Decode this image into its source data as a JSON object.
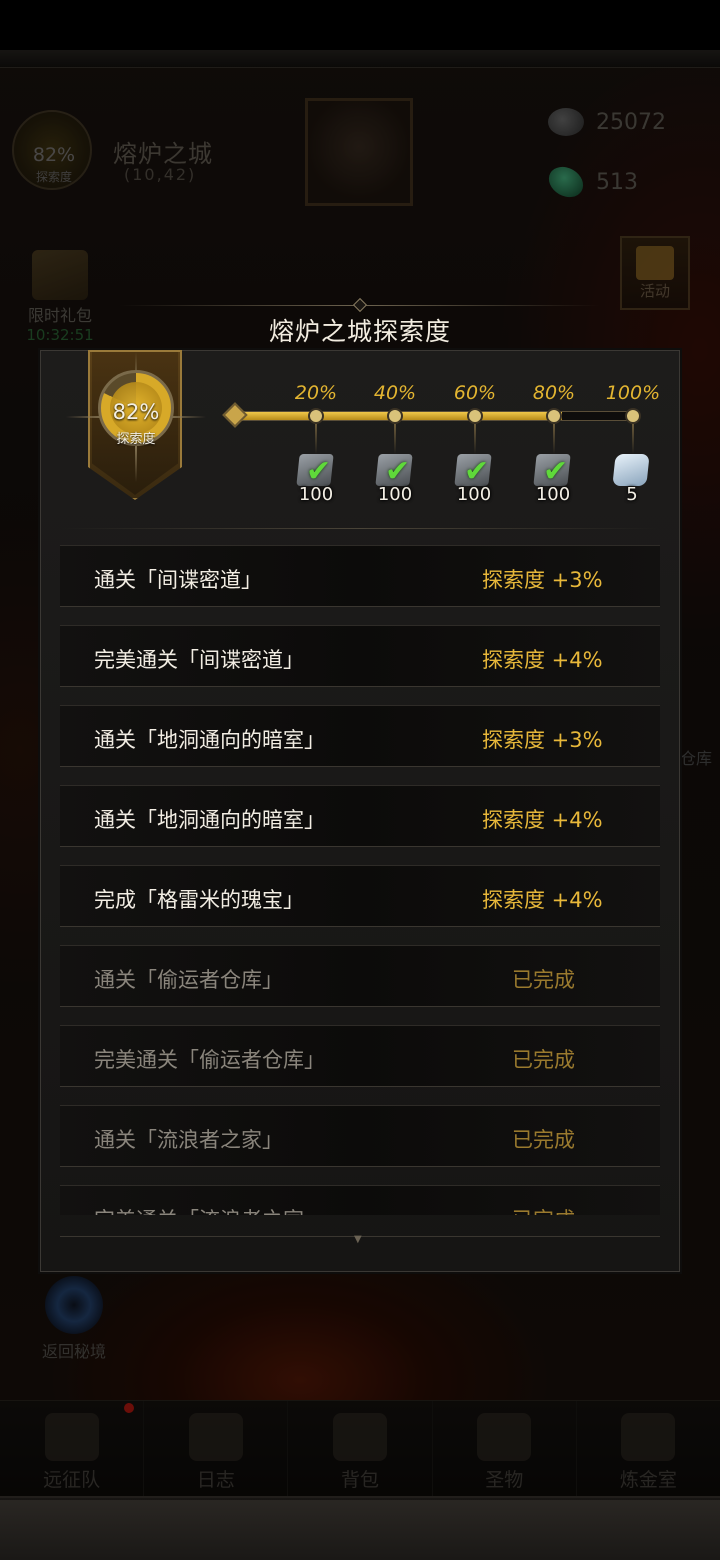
{
  "hud": {
    "exploration_pct": "82%",
    "exploration_label": "探索度",
    "map_name": "熔炉之城",
    "map_coords": "(10,42)",
    "resource_stone": "25072",
    "resource_gem": "513",
    "gift_pack_label": "限时礼包",
    "gift_pack_timer": "10:32:51",
    "activity_label": "活动",
    "warehouse_label": "仓库",
    "portal_label": "返回秘境"
  },
  "dialog": {
    "title": "熔炉之城探索度",
    "exploration_pct": "82%",
    "exploration_label": "探索度",
    "progress_fraction": 0.82,
    "milestones": [
      {
        "pct": "20%",
        "qty": "100",
        "claimed": true,
        "icon": "ore-icon"
      },
      {
        "pct": "40%",
        "qty": "100",
        "claimed": true,
        "icon": "ore-icon"
      },
      {
        "pct": "60%",
        "qty": "100",
        "claimed": true,
        "icon": "ore-icon"
      },
      {
        "pct": "80%",
        "qty": "100",
        "claimed": true,
        "icon": "ore-icon"
      },
      {
        "pct": "100%",
        "qty": "5",
        "claimed": false,
        "icon": "crystal-icon"
      }
    ],
    "tasks": [
      {
        "name": "通关「间谍密道」",
        "reward": "探索度 +3%",
        "done": false
      },
      {
        "name": "完美通关「间谍密道」",
        "reward": "探索度 +4%",
        "done": false
      },
      {
        "name": "通关「地洞通向的暗室」",
        "reward": "探索度 +3%",
        "done": false
      },
      {
        "name": "通关「地洞通向的暗室」",
        "reward": "探索度 +4%",
        "done": false
      },
      {
        "name": "完成「格雷米的瑰宝」",
        "reward": "探索度 +4%",
        "done": false
      },
      {
        "name": "通关「偷运者仓库」",
        "reward": "已完成",
        "done": true
      },
      {
        "name": "完美通关「偷运者仓库」",
        "reward": "已完成",
        "done": true
      },
      {
        "name": "通关「流浪者之家」",
        "reward": "已完成",
        "done": true
      },
      {
        "name": "完美通关「流浪者之家」",
        "reward": "已完成",
        "done": true
      }
    ]
  },
  "nav": {
    "items": [
      "远征队",
      "日志",
      "背包",
      "圣物",
      "炼金室"
    ],
    "icons": [
      "viking-helmet-icon",
      "journal-icon",
      "backpack-icon",
      "relic-icon",
      "alchemy-icon"
    ],
    "badge_on": "远征队"
  },
  "colors": {
    "accent_gold": "#e8b83a",
    "check_green": "#5fd93a",
    "done_text": "#9a7a2e"
  }
}
